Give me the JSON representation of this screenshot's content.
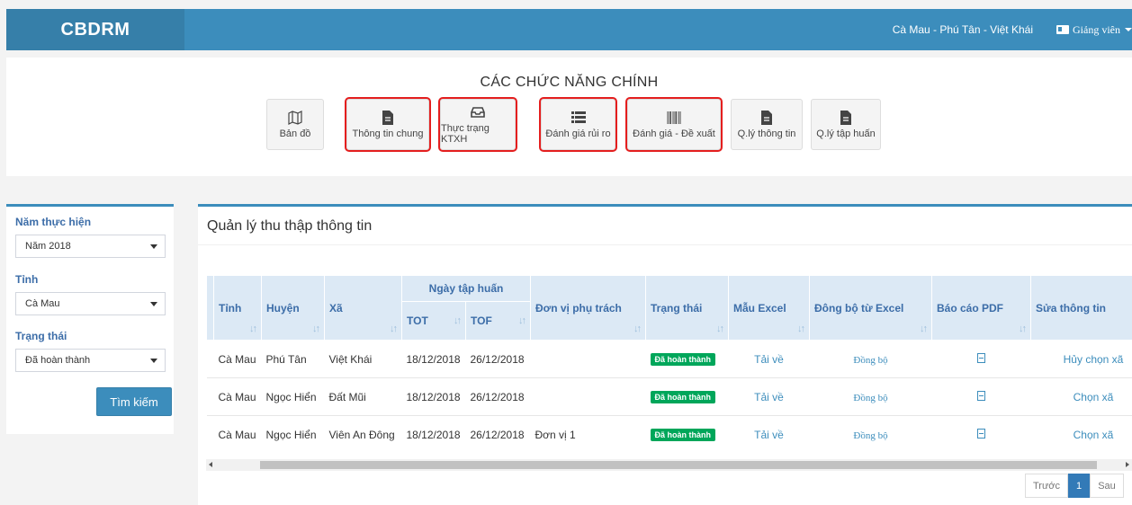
{
  "brand": "CBDRM",
  "header": {
    "location": "Cà Mau - Phú Tân - Việt Khái",
    "user_role": "Giảng viên"
  },
  "functions": {
    "title": "CÁC CHỨC NĂNG CHÍNH",
    "buttons": [
      {
        "label": "Bản đồ",
        "icon": "map-icon",
        "highlighted": false
      },
      {
        "label": "Thông tin chung",
        "icon": "file-icon",
        "highlighted": true
      },
      {
        "label": "Thực trạng KTXH",
        "icon": "inbox-icon",
        "highlighted": true
      },
      {
        "label": "Đánh giá rủi ro",
        "icon": "list-icon",
        "highlighted": true
      },
      {
        "label": "Đánh giá - Đề xuất",
        "icon": "barcode-icon",
        "highlighted": true
      },
      {
        "label": "Q.lý thông tin",
        "icon": "file-icon",
        "highlighted": false
      },
      {
        "label": "Q.lý tập huấn",
        "icon": "file-icon",
        "highlighted": false
      }
    ]
  },
  "filter": {
    "year_label": "Năm thực hiện",
    "year_value": "Năm 2018",
    "province_label": "Tỉnh",
    "province_value": "Cà Mau",
    "status_label": "Trạng thái",
    "status_value": "Đã hoàn thành",
    "search_label": "Tìm kiếm"
  },
  "main": {
    "title": "Quản lý thu thập thông tin",
    "table": {
      "headers": {
        "province": "Tỉnh",
        "district": "Huyện",
        "commune": "Xã",
        "training_date": "Ngày tập huấn",
        "tot": "TOT",
        "tof": "TOF",
        "unit": "Đơn vị phụ trách",
        "status": "Trạng thái",
        "excel_template": "Mẫu Excel",
        "sync_excel": "Đông bộ từ Excel",
        "pdf_report": "Báo cáo PDF",
        "edit_info": "Sửa thông tin"
      },
      "rows": [
        {
          "province": "Cà Mau",
          "district": "Phú Tân",
          "commune": "Việt Khái",
          "tot": "18/12/2018",
          "tof": "26/12/2018",
          "unit": "",
          "status": "Đã hoàn thành",
          "excel": "Tải về",
          "sync": "Đồng bộ",
          "edit": "Hủy chọn xã"
        },
        {
          "province": "Cà Mau",
          "district": "Ngọc Hiển",
          "commune": "Đất Mũi",
          "tot": "18/12/2018",
          "tof": "26/12/2018",
          "unit": "",
          "status": "Đã hoàn thành",
          "excel": "Tải về",
          "sync": "Đồng bộ",
          "edit": "Chọn xã"
        },
        {
          "province": "Cà Mau",
          "district": "Ngọc Hiển",
          "commune": "Viên An Đông",
          "tot": "18/12/2018",
          "tof": "26/12/2018",
          "unit": "Đơn vị 1",
          "status": "Đã hoàn thành",
          "excel": "Tải về",
          "sync": "Đồng bộ",
          "edit": "Chọn xã"
        }
      ]
    },
    "pagination": {
      "prev": "Trước",
      "current": "1",
      "next": "Sau"
    }
  }
}
